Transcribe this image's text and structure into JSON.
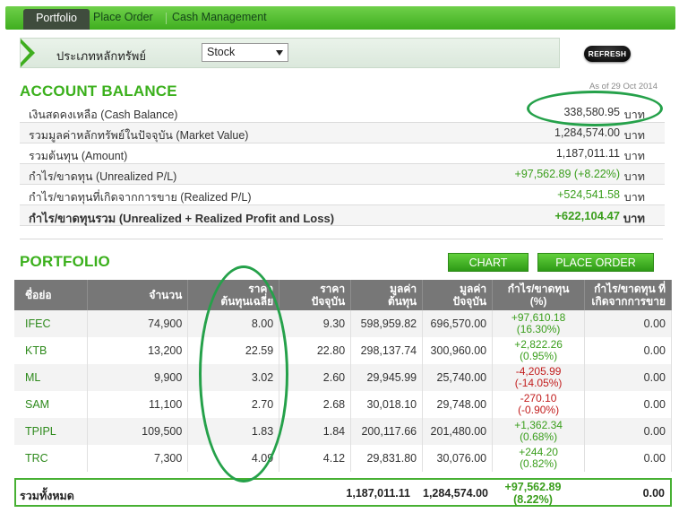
{
  "tabs": [
    {
      "label": "Portfolio",
      "active": true
    },
    {
      "label": "Place Order",
      "active": false
    },
    {
      "label": "Cash Management",
      "active": false
    }
  ],
  "security_type": {
    "label": "ประเภทหลักทรัพย์",
    "selected": "Stock"
  },
  "refresh_label": "REFRESH",
  "account_balance": {
    "title": "ACCOUNT BALANCE",
    "as_of": "As of 29 Oct 2014",
    "rows": [
      {
        "label": "เงินสดคงเหลือ (Cash Balance)",
        "value": "338,580.95",
        "unit": "บาท"
      },
      {
        "label": "รวมมูลค่าหลักทรัพย์ในปัจจุบัน (Market Value)",
        "value": "1,284,574.00",
        "unit": "บาท"
      },
      {
        "label": "รวมต้นทุน (Amount)",
        "value": "1,187,011.11",
        "unit": "บาท"
      },
      {
        "label": "กำไร/ขาดทุน (Unrealized P/L)",
        "value": "+97,562.89 (+8.22%)",
        "unit": "บาท"
      },
      {
        "label": "กำไร/ขาดทุนที่เกิดจากการขาย (Realized P/L)",
        "value": "+524,541.58",
        "unit": "บาท"
      },
      {
        "label": "กำไร/ขาดทุนรวม (Unrealized + Realized Profit and Loss)",
        "value": "+622,104.47",
        "unit": "บาท"
      }
    ]
  },
  "portfolio": {
    "title": "PORTFOLIO",
    "chart_label": "CHART",
    "place_order_label": "PLACE ORDER",
    "headers": {
      "symbol": "ชื่อย่อ",
      "volume": "จำนวน",
      "avg_cost_1": "ราคา",
      "avg_cost_2": "ต้นทุนเฉลี่ย",
      "price_1": "ราคา",
      "price_2": "ปัจจุบัน",
      "amount_1": "มูลค่า",
      "amount_2": "ต้นทุน",
      "market_1": "มูลค่า",
      "market_2": "ปัจจุบัน",
      "upl": "กำไร/ขาดทุน (%)",
      "rpl_1": "กำไร/ขาดทุน ที่",
      "rpl_2": "เกิดจากการขาย"
    },
    "rows": [
      {
        "symbol": "IFEC",
        "volume": "74,900",
        "avg_cost": "8.00",
        "price": "9.30",
        "amount": "598,959.82",
        "market": "696,570.00",
        "upl": "+97,610.18",
        "upl_pct": "(16.30%)",
        "rpl": "0.00"
      },
      {
        "symbol": "KTB",
        "volume": "13,200",
        "avg_cost": "22.59",
        "price": "22.80",
        "amount": "298,137.74",
        "market": "300,960.00",
        "upl": "+2,822.26",
        "upl_pct": "(0.95%)",
        "rpl": "0.00"
      },
      {
        "symbol": "ML",
        "volume": "9,900",
        "avg_cost": "3.02",
        "price": "2.60",
        "amount": "29,945.99",
        "market": "25,740.00",
        "upl": "-4,205.99",
        "upl_pct": "(-14.05%)",
        "rpl": "0.00"
      },
      {
        "symbol": "SAM",
        "volume": "11,100",
        "avg_cost": "2.70",
        "price": "2.68",
        "amount": "30,018.10",
        "market": "29,748.00",
        "upl": "-270.10",
        "upl_pct": "(-0.90%)",
        "rpl": "0.00"
      },
      {
        "symbol": "TPIPL",
        "volume": "109,500",
        "avg_cost": "1.83",
        "price": "1.84",
        "amount": "200,117.66",
        "market": "201,480.00",
        "upl": "+1,362.34",
        "upl_pct": "(0.68%)",
        "rpl": "0.00"
      },
      {
        "symbol": "TRC",
        "volume": "7,300",
        "avg_cost": "4.09",
        "price": "4.12",
        "amount": "29,831.80",
        "market": "30,076.00",
        "upl": "+244.20",
        "upl_pct": "(0.82%)",
        "rpl": "0.00"
      }
    ],
    "total": {
      "label": "รวมทั้งหมด",
      "amount": "1,187,011.11",
      "market": "1,284,574.00",
      "upl": "+97,562.89",
      "upl_pct": "(8.22%)",
      "rpl": "0.00"
    }
  },
  "colors": {
    "brand_green": "#3bb01c",
    "gain": "#3a9e1c",
    "loss": "#c21d1d",
    "highlight_ring": "#25a14a",
    "header_gray": "#777777"
  }
}
